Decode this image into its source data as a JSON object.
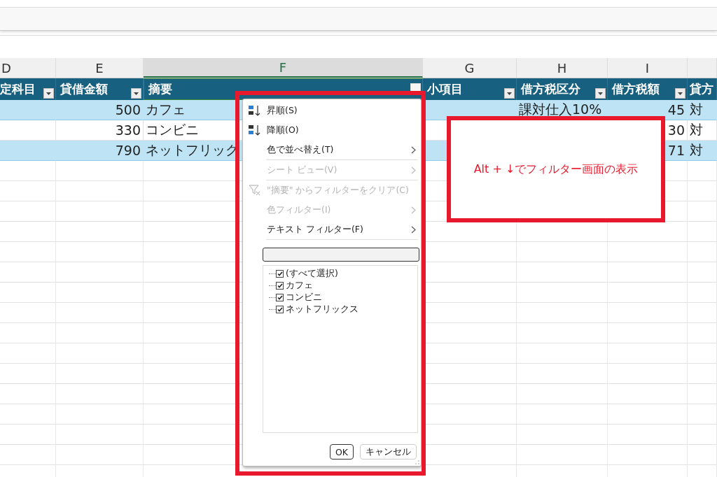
{
  "column_headers": [
    {
      "label": "D",
      "selected": false
    },
    {
      "label": "E",
      "selected": false
    },
    {
      "label": "F",
      "selected": true
    },
    {
      "label": "G",
      "selected": false
    },
    {
      "label": "H",
      "selected": false
    },
    {
      "label": "I",
      "selected": false
    }
  ],
  "table": {
    "columns": [
      {
        "label": "定科目",
        "filter_open": false
      },
      {
        "label": "貸借金額",
        "filter_open": false
      },
      {
        "label": "摘要",
        "filter_open": true
      },
      {
        "label": "小項目",
        "filter_open": false
      },
      {
        "label": "借方税区分",
        "filter_open": false
      },
      {
        "label": "借方税額",
        "filter_open": false
      },
      {
        "label": "貸方"
      }
    ],
    "rows": [
      {
        "banded": true,
        "cells": [
          "",
          "500",
          "カフェ",
          "",
          "課対仕入10%",
          "45",
          "対"
        ]
      },
      {
        "banded": false,
        "cells": [
          "",
          "330",
          "コンビニ",
          "",
          "",
          "30",
          "対"
        ]
      },
      {
        "banded": true,
        "cells": [
          "",
          "790",
          "ネットフリック",
          "",
          "",
          "71",
          "対"
        ]
      }
    ]
  },
  "filter_menu": {
    "items": [
      {
        "kind": "sort-asc",
        "label": "昇順(S)",
        "disabled": false,
        "submenu": false
      },
      {
        "kind": "sort-desc",
        "label": "降順(O)",
        "disabled": false,
        "submenu": false
      },
      {
        "kind": "plain",
        "label": "色で並べ替え(T)",
        "disabled": false,
        "submenu": true
      },
      {
        "kind": "separator"
      },
      {
        "kind": "plain",
        "label": "シート ビュー(V)",
        "disabled": true,
        "submenu": true
      },
      {
        "kind": "separator"
      },
      {
        "kind": "clear-filter",
        "label": "\"摘要\" からフィルターをクリア(C)",
        "disabled": true,
        "submenu": false
      },
      {
        "kind": "plain",
        "label": "色フィルター(I)",
        "disabled": true,
        "submenu": true
      },
      {
        "kind": "plain",
        "label": "テキスト フィルター(F)",
        "disabled": false,
        "submenu": true
      },
      {
        "kind": "separator"
      }
    ],
    "values": [
      {
        "label": "(すべて選択)",
        "checked": true
      },
      {
        "label": "カフェ",
        "checked": true
      },
      {
        "label": "コンビニ",
        "checked": true
      },
      {
        "label": "ネットフリックス",
        "checked": true
      }
    ],
    "buttons": [
      "OK",
      "キャンセル"
    ]
  },
  "callout": {
    "text": "Alt + ↓でフィルター画面の表示"
  }
}
